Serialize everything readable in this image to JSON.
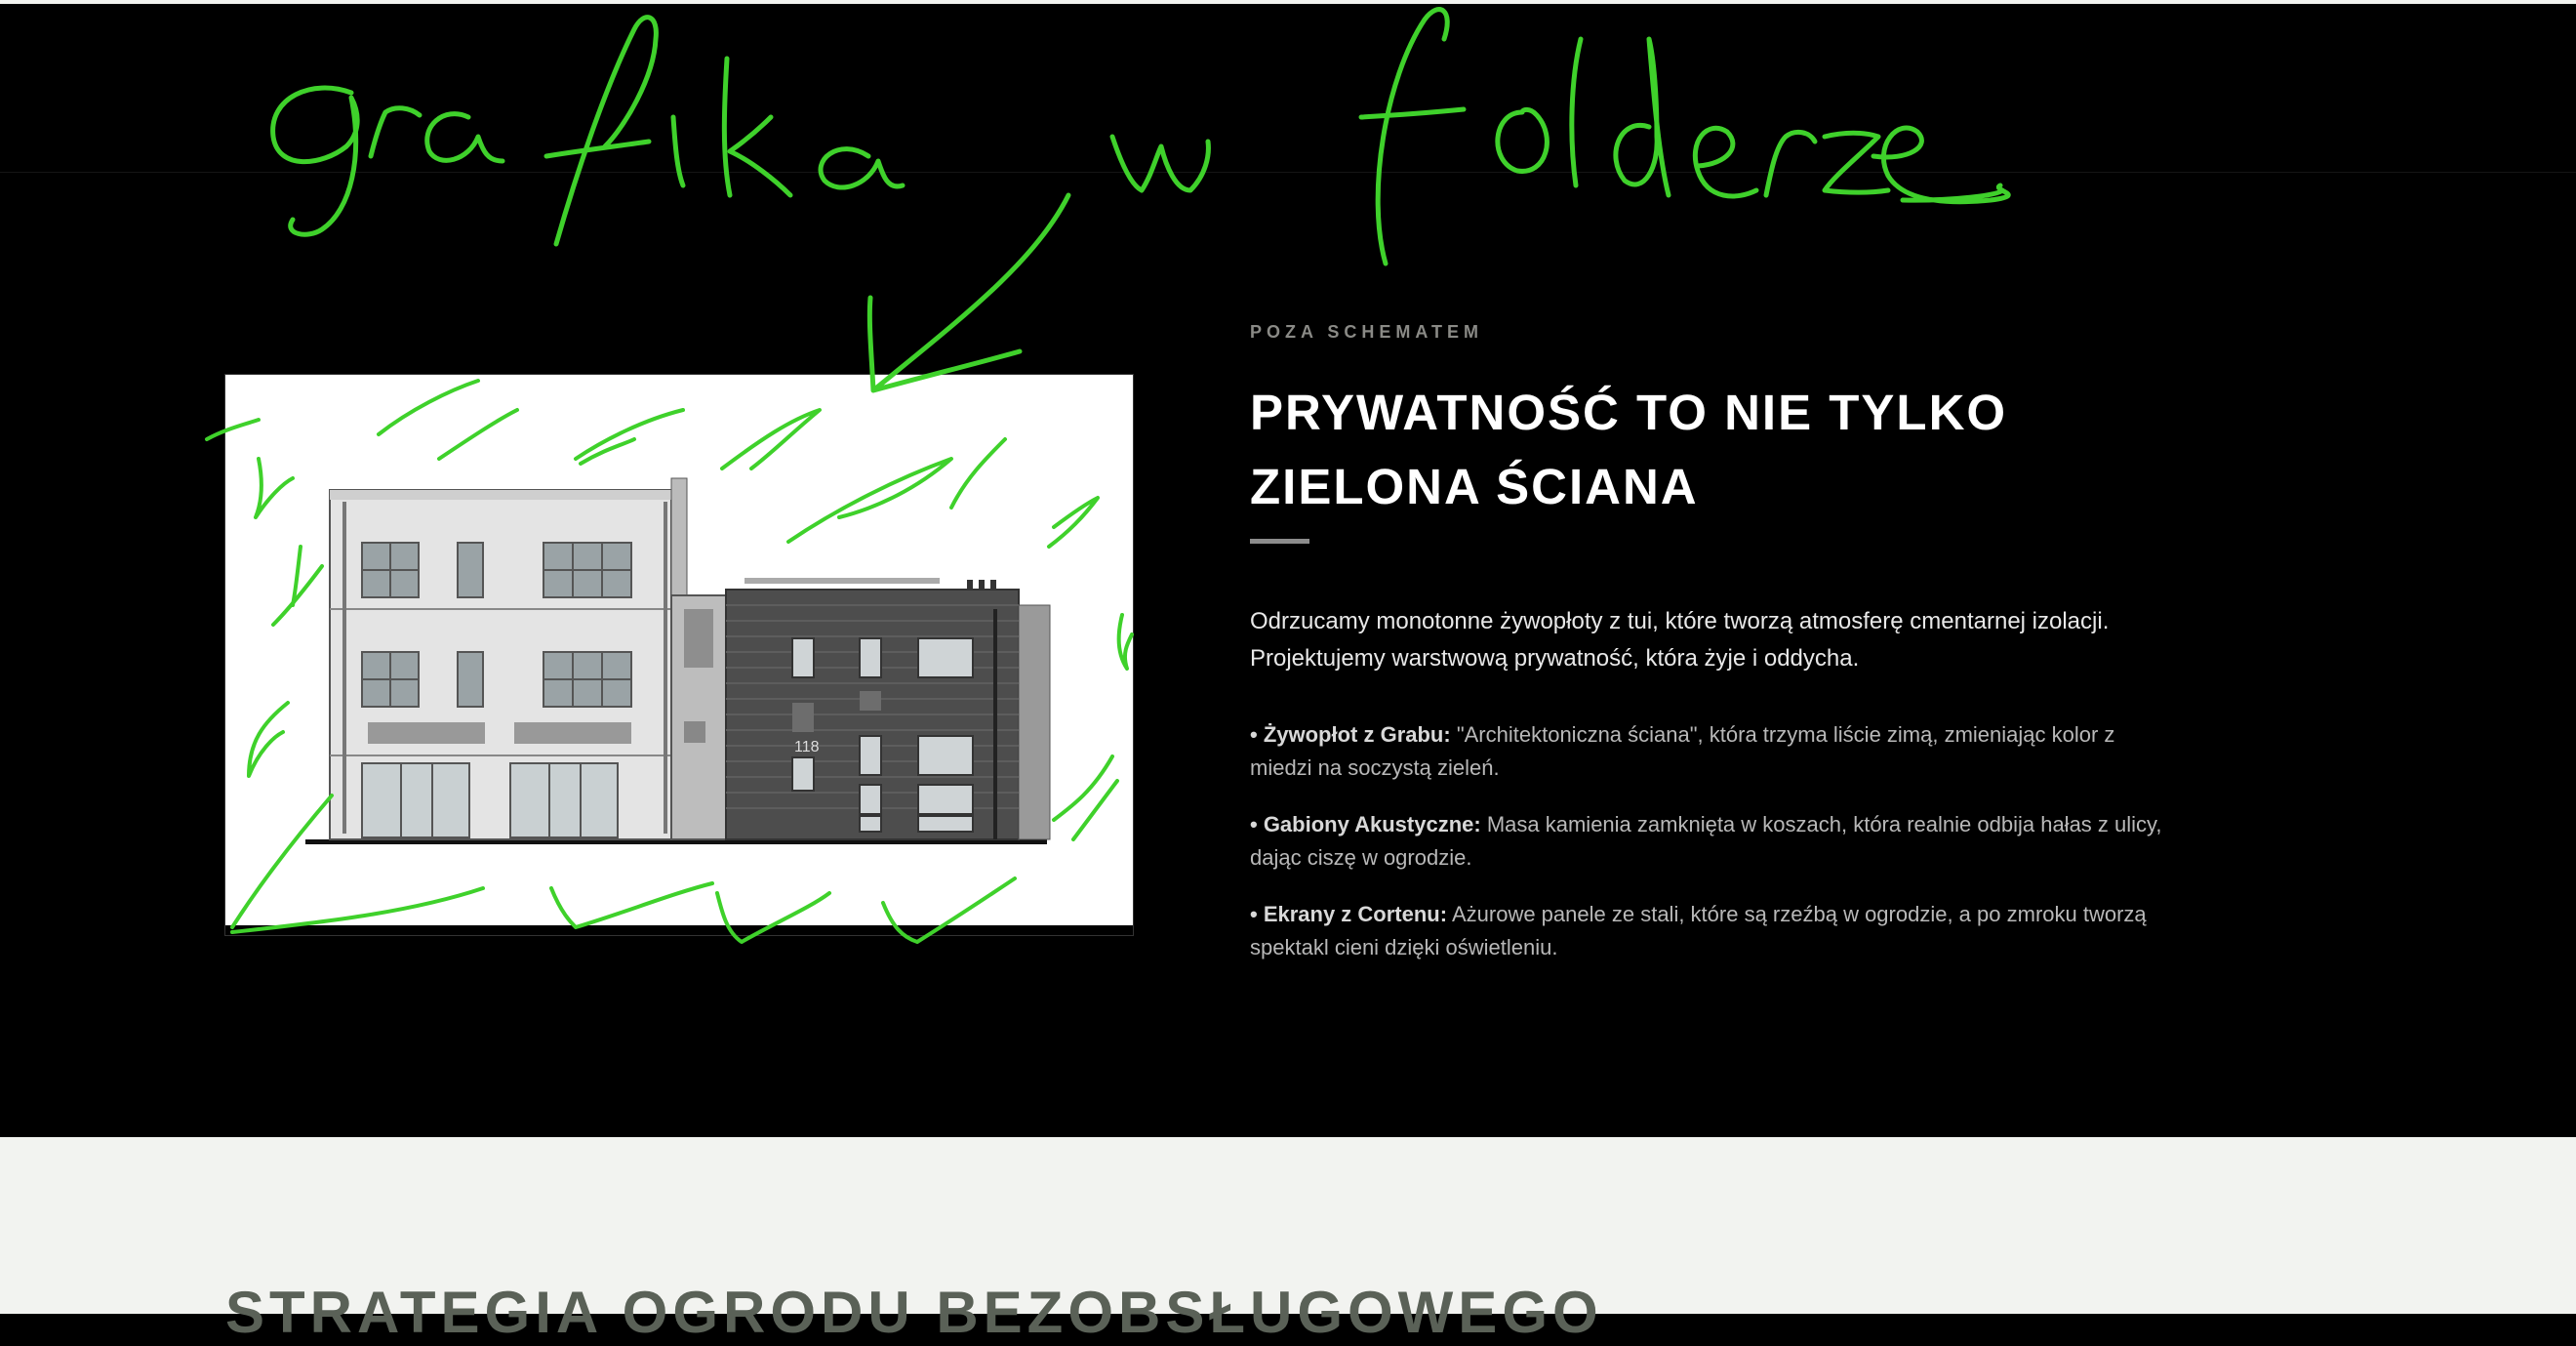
{
  "section": {
    "eyebrow": "POZA SCHEMATEM",
    "heading": "PRYWATNOŚĆ TO NIE TYLKO ZIELONA ŚCIANA",
    "intro": "Odrzucamy monotonne żywopłoty z tui, które tworzą atmosferę cmentarnej izolacji. Projektujemy warstwową prywatność, która żyje i oddycha.",
    "features": [
      {
        "title": "• Żywopłot z Grabu:",
        "text": " \"Architektoniczna ściana\", która trzyma liście zimą, zmieniając kolor z miedzi na soczystą zieleń."
      },
      {
        "title": "• Gabiony Akustyczne:",
        "text": " Masa kamienia zamknięta w koszach, która realnie odbija hałas z ulicy, dając ciszę w ogrodzie."
      },
      {
        "title": "• Ekrany z Cortenu:",
        "text": " Ażurowe panele ze stali, które są rzeźbą w ogrodzie, a po zmroku tworzą spektakl cieni dzięki oświetleniu."
      }
    ]
  },
  "building": {
    "house_number": "118"
  },
  "next_section": {
    "title": "STRATEGIA OGRODU BEZOBSŁUGOWEGO"
  },
  "annotation": {
    "handwritten_text": "grafika w folderze",
    "color": "#3fd12b"
  },
  "colors": {
    "background": "#000000",
    "light_section": "#f2f3f0",
    "accent_rule": "#8c8c8c"
  }
}
